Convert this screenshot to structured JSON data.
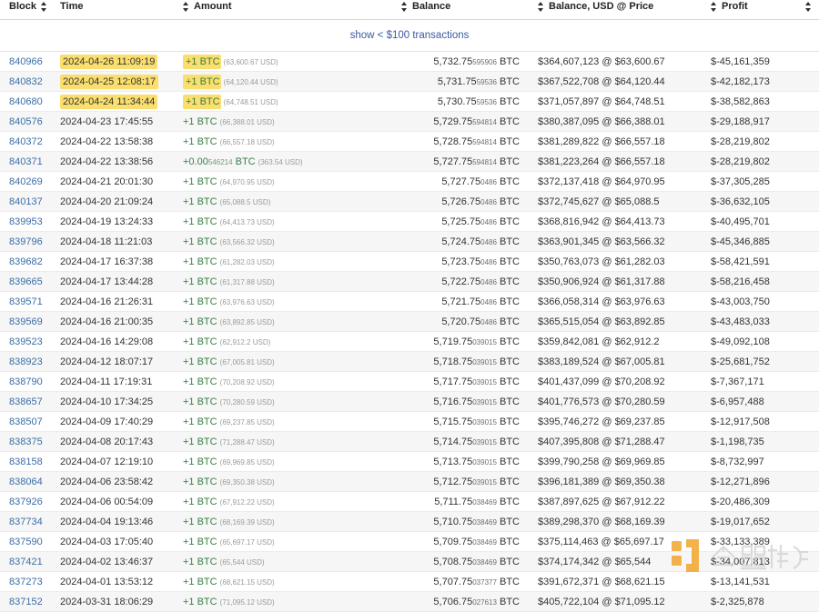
{
  "table": {
    "columns": [
      {
        "key": "block",
        "label": "Block",
        "sortable": true,
        "lead_sort": false
      },
      {
        "key": "time",
        "label": "Time",
        "sortable": true,
        "lead_sort": true
      },
      {
        "key": "amount",
        "label": "Amount",
        "sortable": true,
        "lead_sort": true
      },
      {
        "key": "balance",
        "label": "Balance",
        "sortable": true,
        "lead_sort": true
      },
      {
        "key": "busd",
        "label": "Balance, USD @ Price",
        "sortable": true,
        "lead_sort": true
      },
      {
        "key": "profit",
        "label": "Profit",
        "sortable": true,
        "lead_sort": true
      }
    ],
    "banner_link": "show < $100 transactions",
    "accent_link_color": "#3b6ea5",
    "highlight_color": "#fbdf6e",
    "positive_amount_color": "#3a7d44",
    "rows": [
      {
        "block": "840966",
        "time": "2024-04-26 11:09:19",
        "amount_main": "+1 BTC",
        "amount_sub": "(63,600.67 USD)",
        "balance_int": "5,732.75",
        "balance_dec": "595906",
        "balance_unit": "BTC",
        "busd": "$364,607,123 @ $63,600.67",
        "profit": "$-45,161,359",
        "highlight_time": true,
        "highlight_amount": true
      },
      {
        "block": "840832",
        "time": "2024-04-25 12:08:17",
        "amount_main": "+1 BTC",
        "amount_sub": "(64,120.44 USD)",
        "balance_int": "5,731.75",
        "balance_dec": "59536",
        "balance_unit": "BTC",
        "busd": "$367,522,708 @ $64,120.44",
        "profit": "$-42,182,173",
        "highlight_time": true,
        "highlight_amount": true
      },
      {
        "block": "840680",
        "time": "2024-04-24 11:34:44",
        "amount_main": "+1 BTC",
        "amount_sub": "(64,748.51 USD)",
        "balance_int": "5,730.75",
        "balance_dec": "59536",
        "balance_unit": "BTC",
        "busd": "$371,057,897 @ $64,748.51",
        "profit": "$-38,582,863",
        "highlight_time": true,
        "highlight_amount": true
      },
      {
        "block": "840576",
        "time": "2024-04-23 17:45:55",
        "amount_main": "+1 BTC",
        "amount_sub": "(66,388.01 USD)",
        "balance_int": "5,729.75",
        "balance_dec": "594814",
        "balance_unit": "BTC",
        "busd": "$380,387,095 @ $66,388.01",
        "profit": "$-29,188,917",
        "highlight_time": false,
        "highlight_amount": false
      },
      {
        "block": "840372",
        "time": "2024-04-22 13:58:38",
        "amount_main": "+1 BTC",
        "amount_sub": "(66,557.18 USD)",
        "balance_int": "5,728.75",
        "balance_dec": "594814",
        "balance_unit": "BTC",
        "busd": "$381,289,822 @ $66,557.18",
        "profit": "$-28,219,802",
        "highlight_time": false,
        "highlight_amount": false
      },
      {
        "block": "840371",
        "time": "2024-04-22 13:38:56",
        "amount_main": "+0.00",
        "amount_dec": "546214",
        "amount_unit": "BTC",
        "amount_sub": "(363.54 USD)",
        "balance_int": "5,727.75",
        "balance_dec": "594814",
        "balance_unit": "BTC",
        "busd": "$381,223,264 @ $66,557.18",
        "profit": "$-28,219,802",
        "highlight_time": false,
        "highlight_amount": false
      },
      {
        "block": "840269",
        "time": "2024-04-21 20:01:30",
        "amount_main": "+1 BTC",
        "amount_sub": "(64,970.95 USD)",
        "balance_int": "5,727.75",
        "balance_dec": "0486",
        "balance_unit": "BTC",
        "busd": "$372,137,418 @ $64,970.95",
        "profit": "$-37,305,285",
        "highlight_time": false,
        "highlight_amount": false
      },
      {
        "block": "840137",
        "time": "2024-04-20 21:09:24",
        "amount_main": "+1 BTC",
        "amount_sub": "(65,088.5 USD)",
        "balance_int": "5,726.75",
        "balance_dec": "0486",
        "balance_unit": "BTC",
        "busd": "$372,745,627 @ $65,088.5",
        "profit": "$-36,632,105",
        "highlight_time": false,
        "highlight_amount": false
      },
      {
        "block": "839953",
        "time": "2024-04-19 13:24:33",
        "amount_main": "+1 BTC",
        "amount_sub": "(64,413.73 USD)",
        "balance_int": "5,725.75",
        "balance_dec": "0486",
        "balance_unit": "BTC",
        "busd": "$368,816,942 @ $64,413.73",
        "profit": "$-40,495,701",
        "highlight_time": false,
        "highlight_amount": false
      },
      {
        "block": "839796",
        "time": "2024-04-18 11:21:03",
        "amount_main": "+1 BTC",
        "amount_sub": "(63,566.32 USD)",
        "balance_int": "5,724.75",
        "balance_dec": "0486",
        "balance_unit": "BTC",
        "busd": "$363,901,345 @ $63,566.32",
        "profit": "$-45,346,885",
        "highlight_time": false,
        "highlight_amount": false
      },
      {
        "block": "839682",
        "time": "2024-04-17 16:37:38",
        "amount_main": "+1 BTC",
        "amount_sub": "(61,282.03 USD)",
        "balance_int": "5,723.75",
        "balance_dec": "0486",
        "balance_unit": "BTC",
        "busd": "$350,763,073 @ $61,282.03",
        "profit": "$-58,421,591",
        "highlight_time": false,
        "highlight_amount": false
      },
      {
        "block": "839665",
        "time": "2024-04-17 13:44:28",
        "amount_main": "+1 BTC",
        "amount_sub": "(61,317.88 USD)",
        "balance_int": "5,722.75",
        "balance_dec": "0486",
        "balance_unit": "BTC",
        "busd": "$350,906,924 @ $61,317.88",
        "profit": "$-58,216,458",
        "highlight_time": false,
        "highlight_amount": false
      },
      {
        "block": "839571",
        "time": "2024-04-16 21:26:31",
        "amount_main": "+1 BTC",
        "amount_sub": "(63,976.63 USD)",
        "balance_int": "5,721.75",
        "balance_dec": "0486",
        "balance_unit": "BTC",
        "busd": "$366,058,314 @ $63,976.63",
        "profit": "$-43,003,750",
        "highlight_time": false,
        "highlight_amount": false
      },
      {
        "block": "839569",
        "time": "2024-04-16 21:00:35",
        "amount_main": "+1 BTC",
        "amount_sub": "(63,892.85 USD)",
        "balance_int": "5,720.75",
        "balance_dec": "0486",
        "balance_unit": "BTC",
        "busd": "$365,515,054 @ $63,892.85",
        "profit": "$-43,483,033",
        "highlight_time": false,
        "highlight_amount": false
      },
      {
        "block": "839523",
        "time": "2024-04-16 14:29:08",
        "amount_main": "+1 BTC",
        "amount_sub": "(62,912.2 USD)",
        "balance_int": "5,719.75",
        "balance_dec": "039015",
        "balance_unit": "BTC",
        "busd": "$359,842,081 @ $62,912.2",
        "profit": "$-49,092,108",
        "highlight_time": false,
        "highlight_amount": false
      },
      {
        "block": "838923",
        "time": "2024-04-12 18:07:17",
        "amount_main": "+1 BTC",
        "amount_sub": "(67,005.81 USD)",
        "balance_int": "5,718.75",
        "balance_dec": "039015",
        "balance_unit": "BTC",
        "busd": "$383,189,524 @ $67,005.81",
        "profit": "$-25,681,752",
        "highlight_time": false,
        "highlight_amount": false
      },
      {
        "block": "838790",
        "time": "2024-04-11 17:19:31",
        "amount_main": "+1 BTC",
        "amount_sub": "(70,208.92 USD)",
        "balance_int": "5,717.75",
        "balance_dec": "039015",
        "balance_unit": "BTC",
        "busd": "$401,437,099 @ $70,208.92",
        "profit": "$-7,367,171",
        "highlight_time": false,
        "highlight_amount": false
      },
      {
        "block": "838657",
        "time": "2024-04-10 17:34:25",
        "amount_main": "+1 BTC",
        "amount_sub": "(70,280.59 USD)",
        "balance_int": "5,716.75",
        "balance_dec": "039015",
        "balance_unit": "BTC",
        "busd": "$401,776,573 @ $70,280.59",
        "profit": "$-6,957,488",
        "highlight_time": false,
        "highlight_amount": false
      },
      {
        "block": "838507",
        "time": "2024-04-09 17:40:29",
        "amount_main": "+1 BTC",
        "amount_sub": "(69,237.85 USD)",
        "balance_int": "5,715.75",
        "balance_dec": "039015",
        "balance_unit": "BTC",
        "busd": "$395,746,272 @ $69,237.85",
        "profit": "$-12,917,508",
        "highlight_time": false,
        "highlight_amount": false
      },
      {
        "block": "838375",
        "time": "2024-04-08 20:17:43",
        "amount_main": "+1 BTC",
        "amount_sub": "(71,288.47 USD)",
        "balance_int": "5,714.75",
        "balance_dec": "039015",
        "balance_unit": "BTC",
        "busd": "$407,395,808 @ $71,288.47",
        "profit": "$-1,198,735",
        "highlight_time": false,
        "highlight_amount": false
      },
      {
        "block": "838158",
        "time": "2024-04-07 12:19:10",
        "amount_main": "+1 BTC",
        "amount_sub": "(69,969.85 USD)",
        "balance_int": "5,713.75",
        "balance_dec": "039015",
        "balance_unit": "BTC",
        "busd": "$399,790,258 @ $69,969.85",
        "profit": "$-8,732,997",
        "highlight_time": false,
        "highlight_amount": false
      },
      {
        "block": "838064",
        "time": "2024-04-06 23:58:42",
        "amount_main": "+1 BTC",
        "amount_sub": "(69,350.38 USD)",
        "balance_int": "5,712.75",
        "balance_dec": "039015",
        "balance_unit": "BTC",
        "busd": "$396,181,389 @ $69,350.38",
        "profit": "$-12,271,896",
        "highlight_time": false,
        "highlight_amount": false
      },
      {
        "block": "837926",
        "time": "2024-04-06 00:54:09",
        "amount_main": "+1 BTC",
        "amount_sub": "(67,912.22 USD)",
        "balance_int": "5,711.75",
        "balance_dec": "038469",
        "balance_unit": "BTC",
        "busd": "$387,897,625 @ $67,912.22",
        "profit": "$-20,486,309",
        "highlight_time": false,
        "highlight_amount": false
      },
      {
        "block": "837734",
        "time": "2024-04-04 19:13:46",
        "amount_main": "+1 BTC",
        "amount_sub": "(68,169.39 USD)",
        "balance_int": "5,710.75",
        "balance_dec": "038469",
        "balance_unit": "BTC",
        "busd": "$389,298,370 @ $68,169.39",
        "profit": "$-19,017,652",
        "highlight_time": false,
        "highlight_amount": false
      },
      {
        "block": "837590",
        "time": "2024-04-03 17:05:40",
        "amount_main": "+1 BTC",
        "amount_sub": "(65,697.17 USD)",
        "balance_int": "5,709.75",
        "balance_dec": "038469",
        "balance_unit": "BTC",
        "busd": "$375,114,463 @ $65,697.17",
        "profit": "$-33,133,389",
        "highlight_time": false,
        "highlight_amount": false
      },
      {
        "block": "837421",
        "time": "2024-04-02 13:46:37",
        "amount_main": "+1 BTC",
        "amount_sub": "(65,544 USD)",
        "balance_int": "5,708.75",
        "balance_dec": "038469",
        "balance_unit": "BTC",
        "busd": "$374,174,342 @ $65,544",
        "profit": "$-34,007,813",
        "highlight_time": false,
        "highlight_amount": false
      },
      {
        "block": "837273",
        "time": "2024-04-01 13:53:12",
        "amount_main": "+1 BTC",
        "amount_sub": "(68,621.15 USD)",
        "balance_int": "5,707.75",
        "balance_dec": "037377",
        "balance_unit": "BTC",
        "busd": "$391,672,371 @ $68,621.15",
        "profit": "$-13,141,531",
        "highlight_time": false,
        "highlight_amount": false
      },
      {
        "block": "837152",
        "time": "2024-03-31 18:06:29",
        "amount_main": "+1 BTC",
        "amount_sub": "(71,095.12 USD)",
        "balance_int": "5,706.75",
        "balance_dec": "027613",
        "balance_unit": "BTC",
        "busd": "$405,722,104 @ $71,095.12",
        "profit": "$-2,325,878",
        "highlight_time": false,
        "highlight_amount": false
      }
    ]
  },
  "watermark": {
    "text": "金盟财经",
    "color": "#f0a020"
  }
}
